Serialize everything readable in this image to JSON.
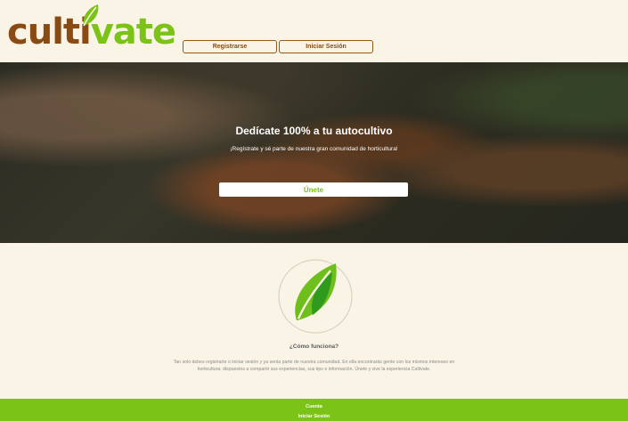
{
  "header": {
    "logo_part1": "culti",
    "logo_part2": "vate",
    "logo_icon": "leaf-icon",
    "nav": {
      "register_label": "Registrarse",
      "login_label": "Iniciar Sesión"
    }
  },
  "hero": {
    "title": "Dedícate 100% a tu autocultivo",
    "subtitle": "¡Regístrate y sé parte de nuestra gran comunidad de horticultura!",
    "cta_label": "Únete"
  },
  "main": {
    "emblem_icon": "leaf-icon",
    "how_title": "¿Cómo funciona?",
    "how_text": "Tan solo debes registrarte o iniciar sesión y ya serás parte de nuestra comunidad. En ella encontrarás gente con los mismos intereses en horticultura, dispuestos a compartir sus experiencias, sus tips e información. Únete y vive la experiencia Cultivate."
  },
  "footer": {
    "account_label": "Cuenta",
    "login_label": "Iniciar Sesión"
  },
  "colors": {
    "brand_brown": "#8a4a14",
    "brand_green": "#7cc318",
    "background": "#f9f4e6"
  }
}
